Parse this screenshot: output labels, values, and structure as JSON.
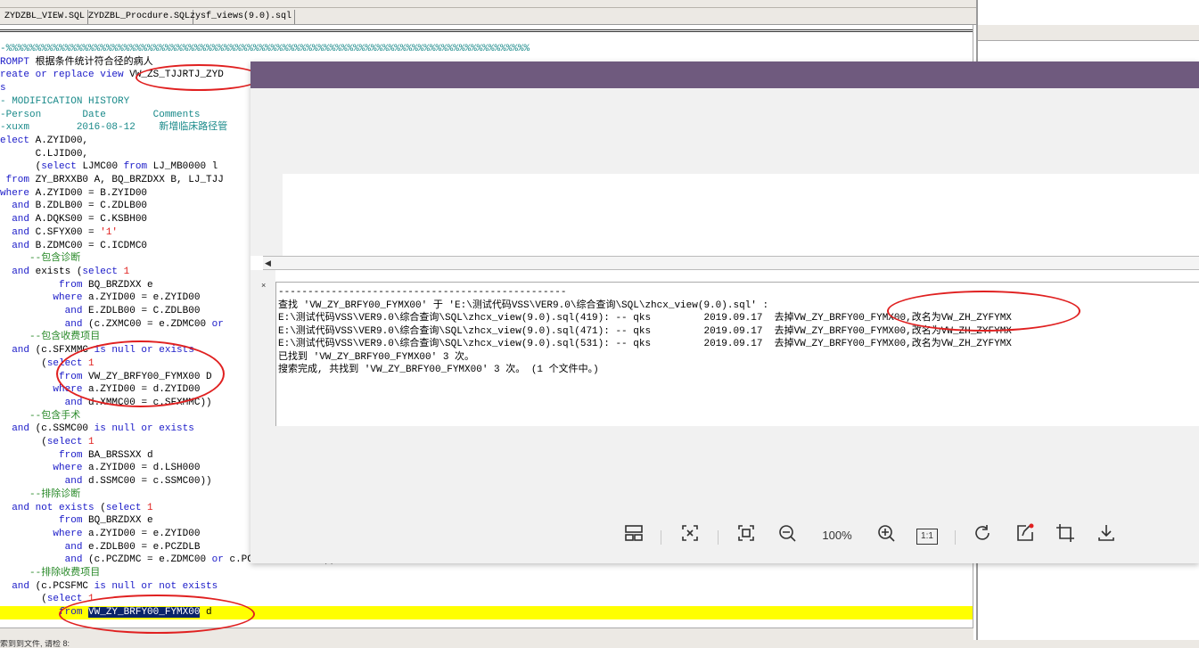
{
  "tabs": [
    "ZYDZBL_VIEW.SQL",
    "ZYDZBL_Procdure.SQL",
    "zysf_views(9.0).sql"
  ],
  "editor_lines": [
    [
      {
        "t": "-%%%%%%%%%%%%%%%%%%%%%%%%%%%%%%%%%%%%%%%%%%%%%%%%%%%%%%%%%%%%%%%%%%%%%%%%%%%%%%%%%%%%%%%%%",
        "c": "cmt"
      }
    ],
    [
      {
        "t": "ROMPT ",
        "c": "kw"
      },
      {
        "t": "根据条件统计符合径的病人",
        "c": ""
      }
    ],
    [
      {
        "t": "reate or replace view ",
        "c": "kw"
      },
      {
        "t": "VW_ZS_TJJRTJ_ZYD",
        "c": ""
      }
    ],
    [
      {
        "t": "s",
        "c": "kw"
      }
    ],
    [
      {
        "t": "- MODIFICATION HISTORY",
        "c": "cmt"
      }
    ],
    [
      {
        "t": "-Person       Date        Comments",
        "c": "cmt"
      }
    ],
    [
      {
        "t": "-xuxm        2016-08-12    新增临床路径管",
        "c": "cmt"
      }
    ],
    [
      {
        "t": "elect ",
        "c": "kw"
      },
      {
        "t": "A.ZYID00,",
        "c": ""
      }
    ],
    [
      {
        "t": "      C.LJID00,",
        "c": ""
      }
    ],
    [
      {
        "t": "      (",
        "c": ""
      },
      {
        "t": "select ",
        "c": "kw"
      },
      {
        "t": "LJMC00 ",
        "c": ""
      },
      {
        "t": "from ",
        "c": "kw"
      },
      {
        "t": "LJ_MB0000 l",
        "c": ""
      }
    ],
    [
      {
        "t": " from ",
        "c": "kw"
      },
      {
        "t": "ZY_BRXXB0 A, BQ_BRZDXX B, LJ_TJJ",
        "c": ""
      }
    ],
    [
      {
        "t": "where ",
        "c": "kw"
      },
      {
        "t": "A.ZYID00 = B.ZYID00",
        "c": ""
      }
    ],
    [
      {
        "t": "  and ",
        "c": "kw"
      },
      {
        "t": "B.ZDLB00 = C.ZDLB00",
        "c": ""
      }
    ],
    [
      {
        "t": "  and ",
        "c": "kw"
      },
      {
        "t": "A.DQKS00 = C.KSBH00",
        "c": ""
      }
    ],
    [
      {
        "t": "  and ",
        "c": "kw"
      },
      {
        "t": "C.SFYX00 = ",
        "c": ""
      },
      {
        "t": "'1'",
        "c": "str"
      }
    ],
    [
      {
        "t": "  and ",
        "c": "kw"
      },
      {
        "t": "B.ZDMC00 = C.ICDMC0",
        "c": ""
      }
    ],
    [
      {
        "t": "     --包含诊断",
        "c": "cn"
      }
    ],
    [
      {
        "t": "  and ",
        "c": "kw"
      },
      {
        "t": "exists (",
        "c": ""
      },
      {
        "t": "select ",
        "c": "kw"
      },
      {
        "t": "1",
        "c": "str"
      }
    ],
    [
      {
        "t": "          from ",
        "c": "kw"
      },
      {
        "t": "BQ_BRZDXX e",
        "c": ""
      }
    ],
    [
      {
        "t": "         where ",
        "c": "kw"
      },
      {
        "t": "a.ZYID00 = e.ZYID00",
        "c": ""
      }
    ],
    [
      {
        "t": "           and ",
        "c": "kw"
      },
      {
        "t": "E.ZDLB00 = C.ZDLB00",
        "c": ""
      }
    ],
    [
      {
        "t": "           and ",
        "c": "kw"
      },
      {
        "t": "(c.ZXMC00 = e.ZDMC00 ",
        "c": ""
      },
      {
        "t": "or",
        "c": "kw"
      }
    ],
    [
      {
        "t": "     --包含收费项目",
        "c": "cn"
      }
    ],
    [
      {
        "t": "  and ",
        "c": "kw"
      },
      {
        "t": "(c.SFXMMC ",
        "c": ""
      },
      {
        "t": "is null or exists",
        "c": "kw"
      }
    ],
    [
      {
        "t": "       (",
        "c": ""
      },
      {
        "t": "select ",
        "c": "kw"
      },
      {
        "t": "1",
        "c": "str"
      }
    ],
    [
      {
        "t": "          from ",
        "c": "kw"
      },
      {
        "t": "VW_ZY_BRFY00_FYMX00 D",
        "c": ""
      }
    ],
    [
      {
        "t": "         where ",
        "c": "kw"
      },
      {
        "t": "a.ZYID00 = d.ZYID00",
        "c": ""
      }
    ],
    [
      {
        "t": "           and ",
        "c": "kw"
      },
      {
        "t": "d.XMMC00 = c.SFXMMC))",
        "c": ""
      }
    ],
    [
      {
        "t": "     --包含手术",
        "c": "cn"
      }
    ],
    [
      {
        "t": "  and ",
        "c": "kw"
      },
      {
        "t": "(c.SSMC00 ",
        "c": ""
      },
      {
        "t": "is null or exists",
        "c": "kw"
      }
    ],
    [
      {
        "t": "       (",
        "c": ""
      },
      {
        "t": "select ",
        "c": "kw"
      },
      {
        "t": "1",
        "c": "str"
      }
    ],
    [
      {
        "t": "          from ",
        "c": "kw"
      },
      {
        "t": "BA_BRSSXX d",
        "c": ""
      }
    ],
    [
      {
        "t": "         where ",
        "c": "kw"
      },
      {
        "t": "a.ZYID00 = d.LSH000",
        "c": ""
      }
    ],
    [
      {
        "t": "           and ",
        "c": "kw"
      },
      {
        "t": "d.SSMC00 = c.SSMC00))",
        "c": ""
      }
    ],
    [
      {
        "t": "     --排除诊断",
        "c": "cn"
      }
    ],
    [
      {
        "t": "  and not exists ",
        "c": "kw"
      },
      {
        "t": "(",
        "c": ""
      },
      {
        "t": "select ",
        "c": "kw"
      },
      {
        "t": "1",
        "c": "str"
      }
    ],
    [
      {
        "t": "          from ",
        "c": "kw"
      },
      {
        "t": "BQ_BRZDXX e",
        "c": ""
      }
    ],
    [
      {
        "t": "         where ",
        "c": "kw"
      },
      {
        "t": "a.ZYID00 = e.ZYID00",
        "c": ""
      }
    ],
    [
      {
        "t": "           and ",
        "c": "kw"
      },
      {
        "t": "e.ZDLB00 = e.PCZDLB",
        "c": ""
      }
    ],
    [
      {
        "t": "           and ",
        "c": "kw"
      },
      {
        "t": "(c.PCZDMC = e.ZDMC00 ",
        "c": ""
      },
      {
        "t": "or ",
        "c": "kw"
      },
      {
        "t": "c.PCZDMC is null))",
        "c": ""
      }
    ],
    [
      {
        "t": "     --排除收费项目",
        "c": "cn"
      }
    ],
    [
      {
        "t": "  and ",
        "c": "kw"
      },
      {
        "t": "(c.PCSFMC ",
        "c": ""
      },
      {
        "t": "is null or not exists",
        "c": "kw"
      }
    ],
    [
      {
        "t": "       (",
        "c": ""
      },
      {
        "t": "select ",
        "c": "kw"
      },
      {
        "t": "1",
        "c": "str"
      }
    ],
    [
      {
        "t": "          from ",
        "c": "kw"
      },
      {
        "t": "VW_ZY_BRFY00_FYMX00",
        "c": "sel"
      },
      {
        "t": " d",
        "c": ""
      }
    ]
  ],
  "find_output": [
    "-------------------------------------------------",
    "查找 'VW_ZY_BRFY00_FYMX00' 于 'E:\\测试代码VSS\\VER9.0\\综合查询\\SQL\\zhcx_view(9.0).sql' :",
    "E:\\测试代码VSS\\VER9.0\\综合查询\\SQL\\zhcx_view(9.0).sql(419): -- qks         2019.09.17  去掉VW_ZY_BRFY00_FYMX00,改名为VW_ZH_ZYFYMX",
    "E:\\测试代码VSS\\VER9.0\\综合查询\\SQL\\zhcx_view(9.0).sql(471): -- qks         2019.09.17  去掉VW_ZY_BRFY00_FYMX00,改名为VW_ZH_ZYFYMX",
    "E:\\测试代码VSS\\VER9.0\\综合查询\\SQL\\zhcx_view(9.0).sql(531): -- qks         2019.09.17  去掉VW_ZY_BRFY00_FYMX00,改名为VW_ZH_ZYFYMX",
    "已找到 'VW_ZY_BRFY00_FYMX00' 3 次。",
    "搜索完成, 共找到 'VW_ZY_BRFY00_FYMX00' 3 次。 (1 个文件中。)"
  ],
  "viewer": {
    "zoom_label": "100%",
    "one_to_one": "1:1",
    "icons": [
      "layout-icon",
      "fit-screen-icon",
      "fullscreen-icon",
      "zoom-out-icon",
      "zoom-in-icon",
      "actual-size-icon",
      "rotate-icon",
      "edit-icon",
      "crop-icon",
      "download-icon"
    ]
  },
  "status_bar": {
    "left_text": "索到到文件, 请检 8:"
  },
  "colors": {
    "viewer_title": "#6f5a7e",
    "highlight_line": "#ffff00",
    "annotation_oval": "#e02020"
  }
}
